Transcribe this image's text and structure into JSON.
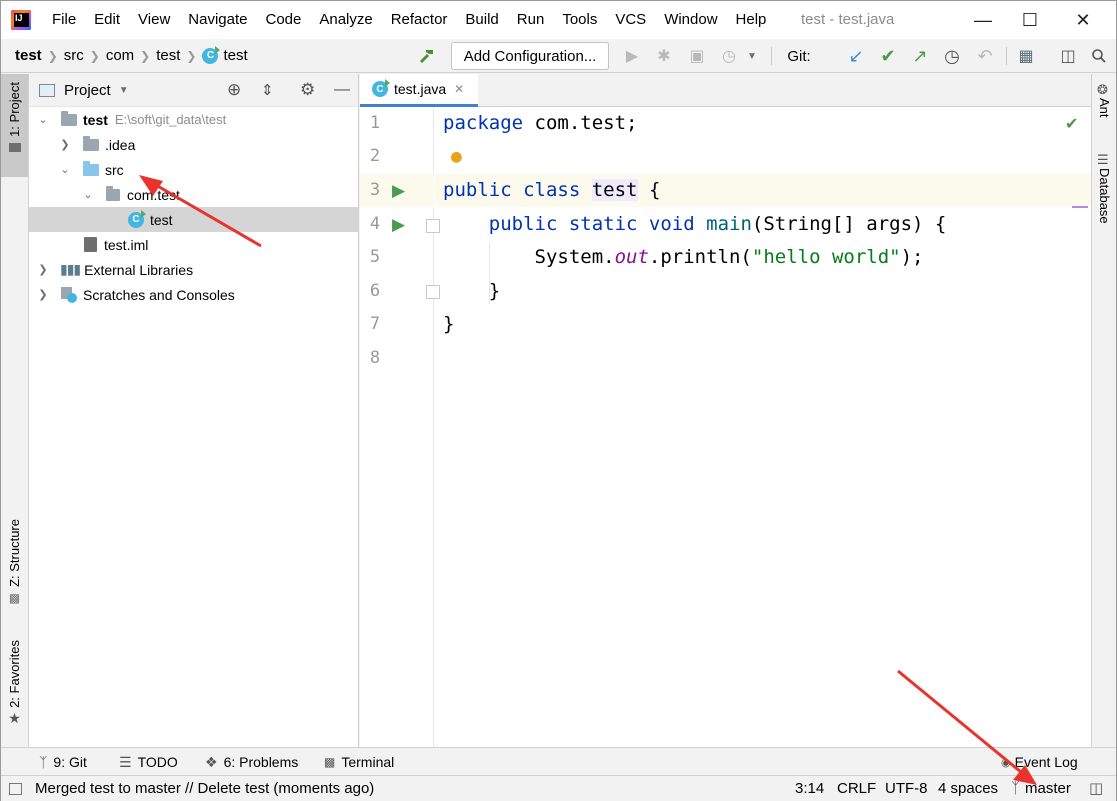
{
  "menu": [
    "File",
    "Edit",
    "View",
    "Navigate",
    "Code",
    "Analyze",
    "Refactor",
    "Build",
    "Run",
    "Tools",
    "VCS",
    "Window",
    "Help"
  ],
  "window_title": "test - test.java",
  "breadcrumb": [
    "test",
    "src",
    "com",
    "test",
    "test"
  ],
  "toolbar": {
    "add_configuration": "Add Configuration...",
    "git_label": "Git:"
  },
  "left_tabs": {
    "project": "1: Project",
    "structure": "Z: Structure",
    "favorites": "2: Favorites"
  },
  "right_tabs": {
    "ant": "Ant",
    "database": "Database"
  },
  "project_panel": {
    "title": "Project",
    "tree": [
      {
        "label": "test",
        "path": "E:\\soft\\git_data\\test"
      },
      {
        "label": ".idea"
      },
      {
        "label": "src"
      },
      {
        "label": "com.test"
      },
      {
        "label": "test"
      },
      {
        "label": "test.iml"
      },
      {
        "label": "External Libraries"
      },
      {
        "label": "Scratches and Consoles"
      }
    ]
  },
  "editor": {
    "tab": "test.java",
    "line_numbers": [
      "1",
      "2",
      "3",
      "4",
      "5",
      "6",
      "7",
      "8"
    ]
  },
  "bottom_tools": {
    "git": "9: Git",
    "todo": "TODO",
    "problems": "6: Problems",
    "terminal": "Terminal",
    "event_log": "Event Log"
  },
  "status": {
    "message": "Merged test to master // Delete test (moments ago)",
    "position": "3:14",
    "line_sep": "CRLF",
    "encoding": "UTF-8",
    "indent": "4 spaces",
    "branch": "master"
  },
  "colors": {
    "keyword": "#0033b3",
    "string": "#067d17",
    "static_field": "#871094",
    "annotation_arrow": "#e8332e",
    "selection": "#d5d5d5"
  }
}
